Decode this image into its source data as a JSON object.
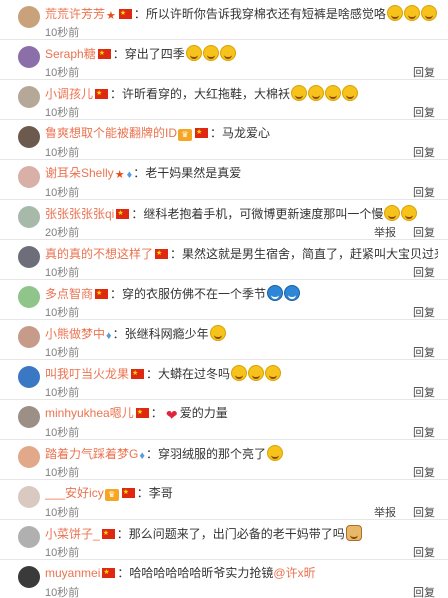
{
  "comments": [
    {
      "user": "荒荒许芳芳",
      "badges": [
        "star",
        "flag"
      ],
      "text": "所以许昕你告诉我穿棉衣还有短裤是啥感觉咯",
      "emojis": 3,
      "emoji_style": "yellow",
      "time": "10秒前",
      "reply": "",
      "report": "",
      "avatar_color": "#c9a17a"
    },
    {
      "user": "Seraph糖",
      "badges": [
        "flag"
      ],
      "text": "穿出了四季",
      "emojis": 3,
      "emoji_style": "yellow",
      "time": "10秒前",
      "reply": "回复",
      "report": "",
      "avatar_color": "#8a6fa8"
    },
    {
      "user": "小调孩儿",
      "badges": [
        "flag"
      ],
      "text": "许昕看穿的，大红拖鞋，大棉袄",
      "emojis": 4,
      "emoji_style": "yellow",
      "time": "10秒前",
      "reply": "回复",
      "report": "",
      "avatar_color": "#b5a898"
    },
    {
      "user": "鲁爽想取个能被翻牌的ID",
      "badges": [
        "grade",
        "flag"
      ],
      "text": "马龙爱心",
      "emojis": 0,
      "emoji_style": "",
      "time": "10秒前",
      "reply": "回复",
      "report": "",
      "avatar_color": "#6c5a4e"
    },
    {
      "user": "谢耳朵Shelly",
      "badges": [
        "star",
        "drop"
      ],
      "text": "老干妈果然是真爱",
      "emojis": 0,
      "emoji_style": "",
      "time": "10秒前",
      "reply": "回复",
      "report": "",
      "avatar_color": "#d8b0a8"
    },
    {
      "user": "张张张张张qi",
      "badges": [
        "flag"
      ],
      "text": "继科老抱着手机，可微博更新速度那叫一个慢",
      "emojis": 2,
      "emoji_style": "yellow",
      "time": "20秒前",
      "reply": "回复",
      "report": "举报",
      "avatar_color": "#a7b9a8"
    },
    {
      "user": "真的真的不想这样了",
      "badges": [
        "flag"
      ],
      "text": "果然这就是男生宿舍，简直了，赶紧叫大宝贝过来给你们理一理",
      "emojis": 1,
      "emoji_style": "cat",
      "time": "10秒前",
      "reply": "回复",
      "report": "",
      "avatar_color": "#6e6e7a"
    },
    {
      "user": "多点智商",
      "badges": [
        "flag"
      ],
      "text": "穿的衣服仿佛不在一个季节",
      "emojis": 2,
      "emoji_style": "blue",
      "time": "10秒前",
      "reply": "回复",
      "report": "",
      "avatar_color": "#8fc48a"
    },
    {
      "user": "小熊做梦中",
      "badges": [
        "drop"
      ],
      "text": "张继科网瘾少年",
      "emojis": 1,
      "emoji_style": "yellow",
      "time": "10秒前",
      "reply": "回复",
      "report": "",
      "avatar_color": "#c79b8a"
    },
    {
      "user": "叫我叮当火龙果",
      "badges": [
        "flag"
      ],
      "text": "大蟒在过冬吗",
      "emojis": 3,
      "emoji_style": "yellow",
      "time": "10秒前",
      "reply": "回复",
      "report": "",
      "avatar_color": "#3b78c4"
    },
    {
      "user": "minhyukhea嗯儿",
      "badges": [
        "flag"
      ],
      "text": "爱的力量",
      "emojis": 0,
      "heart_first": true,
      "emoji_style": "",
      "time": "10秒前",
      "reply": "回复",
      "report": "",
      "avatar_color": "#9c8f86"
    },
    {
      "user": "踏着力气踩着梦G",
      "badges": [
        "drop"
      ],
      "text": "穿羽绒服的那个亮了",
      "emojis": 1,
      "emoji_style": "yellow",
      "time": "10秒前",
      "reply": "回复",
      "report": "",
      "avatar_color": "#e2a88a"
    },
    {
      "user": "___安好icy",
      "badges": [
        "grade",
        "flag"
      ],
      "text": "李哥",
      "emojis": 0,
      "emoji_style": "",
      "time": "10秒前",
      "reply": "回复",
      "report": "举报",
      "avatar_color": "#d9c9c0"
    },
    {
      "user": "小菜饼子_",
      "badges": [
        "flag"
      ],
      "text": "那么问题来了，出门必备的老干妈带了吗",
      "emojis": 1,
      "emoji_style": "cat",
      "time": "10秒前",
      "reply": "回复",
      "report": "",
      "avatar_color": "#b0b0b0"
    },
    {
      "user": "muyanmei",
      "badges": [
        "flag"
      ],
      "text": "哈哈哈哈哈哈昕爷实力抢镜",
      "mention": "@许x昕",
      "emojis": 0,
      "emoji_style": "",
      "time": "10秒前",
      "reply": "回复",
      "report": "",
      "avatar_color": "#3a3a3a"
    }
  ],
  "icons": {
    "flag": "china-flag-icon",
    "star": "star-badge-icon",
    "drop": "drop-badge-icon",
    "grade": "level-badge-icon"
  }
}
